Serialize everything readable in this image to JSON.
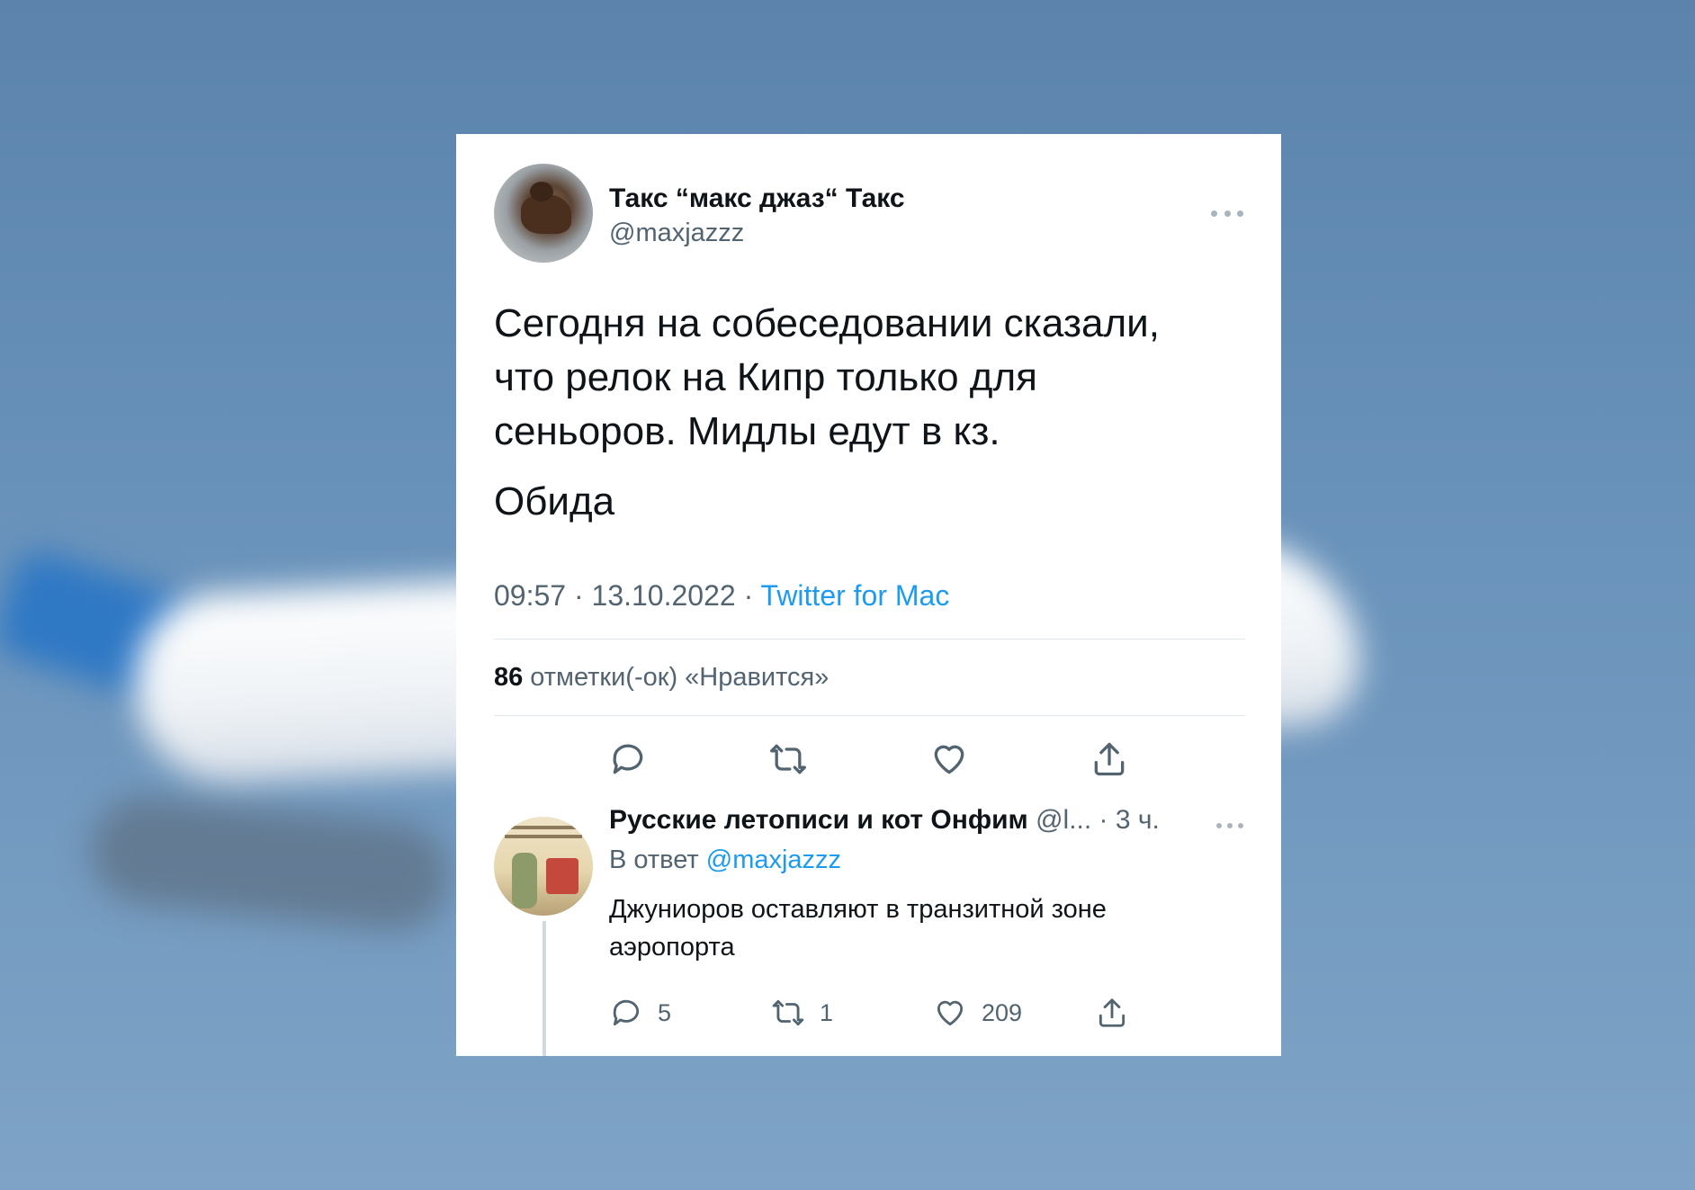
{
  "tweet": {
    "display_name": "Такс “макс джаз“ Такс",
    "handle": "@maxjazzz",
    "text_line1": "Сегодня на собеседовании сказали, что релок на Кипр только для сеньоров. Мидлы едут в кз.",
    "text_line2": "Обида",
    "time": "09:57 · 13.10.2022 ·",
    "source": "Twitter for Mac",
    "likes_count": "86",
    "likes_label": "отметки(-ок) «Нравится»"
  },
  "reply": {
    "display_name": "Русские летописи и кот Онфим",
    "handle": "@l...",
    "time": "· 3 ч.",
    "reply_to_label": "В ответ",
    "reply_to_handle": "@maxjazzz",
    "text": "Джуниоров оставляют в транзитной зоне аэропорта",
    "replies": "5",
    "retweets": "1",
    "likes": "209"
  },
  "icons": {
    "reply": "reply-icon",
    "retweet": "retweet-icon",
    "like": "heart-icon",
    "share": "share-icon",
    "more": "more-icon"
  },
  "colors": {
    "accent": "#1d9bf0",
    "secondary_text": "#536471",
    "primary_text": "#0f1419"
  }
}
